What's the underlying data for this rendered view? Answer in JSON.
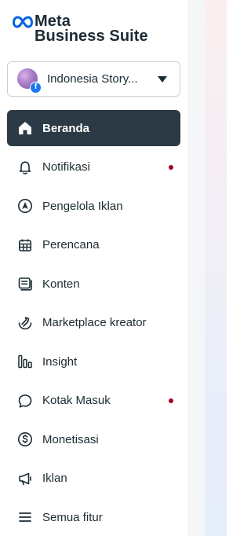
{
  "brand": {
    "line1": "Meta",
    "line2": "Business Suite",
    "logo_icon": "meta-infinity-icon",
    "color": "#0064e0"
  },
  "account": {
    "name": "Indonesia Story...",
    "avatar_icon": "page-avatar",
    "badge_icon": "facebook-icon",
    "dropdown_icon": "caret-down-icon"
  },
  "nav": {
    "items": [
      {
        "label": "Beranda",
        "icon": "home-icon",
        "active": true,
        "notification": false
      },
      {
        "label": "Notifikasi",
        "icon": "bell-icon",
        "active": false,
        "notification": true
      },
      {
        "label": "Pengelola Iklan",
        "icon": "ads-manager-icon",
        "active": false,
        "notification": false
      },
      {
        "label": "Perencana",
        "icon": "calendar-icon",
        "active": false,
        "notification": false
      },
      {
        "label": "Konten",
        "icon": "content-icon",
        "active": false,
        "notification": false
      },
      {
        "label": "Marketplace kreator",
        "icon": "creator-marketplace-icon",
        "active": false,
        "notification": false
      },
      {
        "label": "Insight",
        "icon": "insights-icon",
        "active": false,
        "notification": false
      },
      {
        "label": "Kotak Masuk",
        "icon": "inbox-icon",
        "active": false,
        "notification": true
      },
      {
        "label": "Monetisasi",
        "icon": "dollar-icon",
        "active": false,
        "notification": false
      },
      {
        "label": "Iklan",
        "icon": "megaphone-icon",
        "active": false,
        "notification": false
      },
      {
        "label": "Semua fitur",
        "icon": "menu-icon",
        "active": false,
        "notification": false
      }
    ]
  },
  "colors": {
    "active_bg": "#2b3a44",
    "text": "#1c2b33",
    "notification_dot": "#a5001f"
  }
}
